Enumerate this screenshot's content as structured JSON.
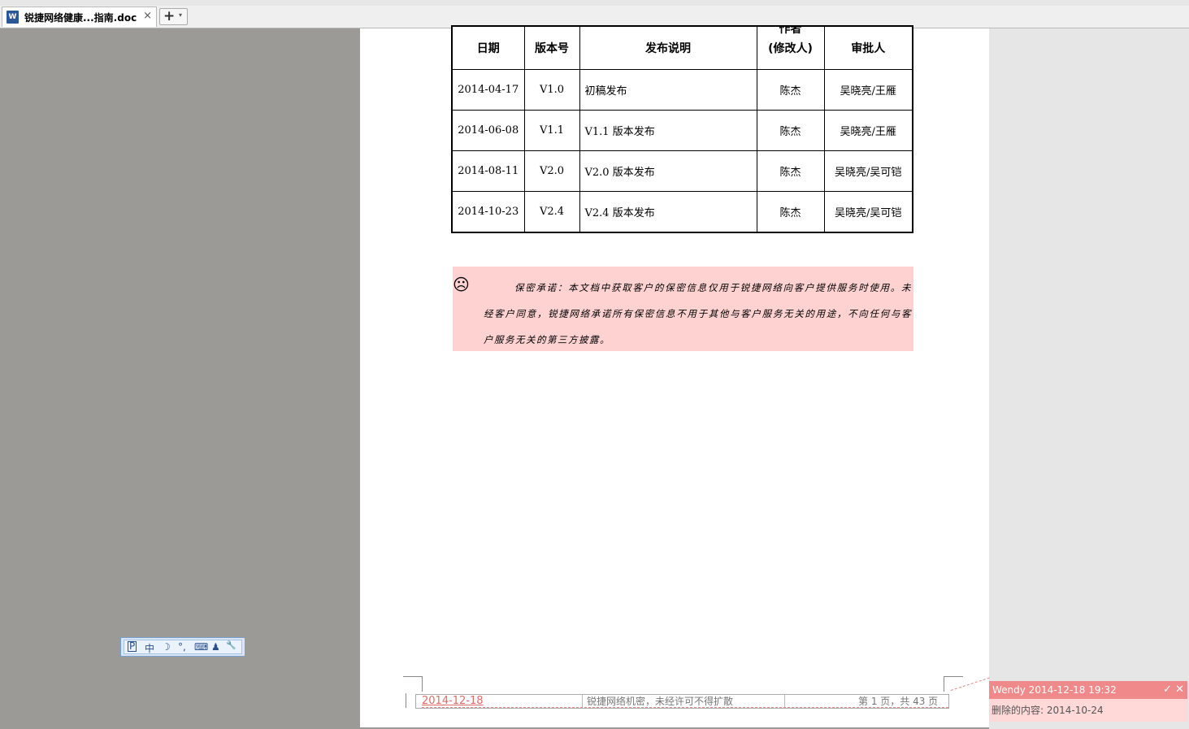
{
  "tab": {
    "title": "锐捷网络健康...指南.doc",
    "icon": "word-doc-icon",
    "close": "×",
    "new_tab": "+",
    "dropdown": "▾"
  },
  "history_table": {
    "headers": [
      "日期",
      "版本号",
      "发布说明",
      "作者",
      "审批人"
    ],
    "author_sub": "(修改人)",
    "rows": [
      [
        "2014-04-17",
        "V1.0",
        "初稿发布",
        "陈杰",
        "吴晓亮/王雁"
      ],
      [
        "2014-06-08",
        "V1.1",
        "V1.1 版本发布",
        "陈杰",
        "吴晓亮/王雁"
      ],
      [
        "2014-08-11",
        "V2.0",
        "V2.0 版本发布",
        "陈杰",
        "吴晓亮/吴可铠"
      ],
      [
        "2014-10-23",
        "V2.4",
        "V2.4 版本发布",
        "陈杰",
        "吴晓亮/吴可铠"
      ]
    ]
  },
  "confidential": {
    "icon": "☹",
    "text": "保密承诺：本文档中获取客户的保密信息仅用于锐捷网络向客户提供服务时使用。未经客户同意，锐捷网络承诺所有保密信息不用于其他与客户服务无关的用途，不向任何与客户服务无关的第三方披露。"
  },
  "footer": {
    "date": "2014-12-18",
    "confidential_note": "锐捷网络机密，未经许可不得扩散",
    "pages": "第 1 页，共 43 页"
  },
  "comment": {
    "header": "Wendy 2014-12-18 19:32",
    "accept": "✓",
    "reject": "✕",
    "body": "删除的内容: 2014-10-24"
  },
  "ime": {
    "items": [
      "P",
      "中",
      "☽",
      "°,",
      "⌨",
      "♟",
      "🔧"
    ]
  },
  "colors": {
    "workspace": "#9b9a96",
    "confidential_bg": "#ffd2d2",
    "comment_header": "#f08a8a",
    "revision": "#e06a6a"
  }
}
